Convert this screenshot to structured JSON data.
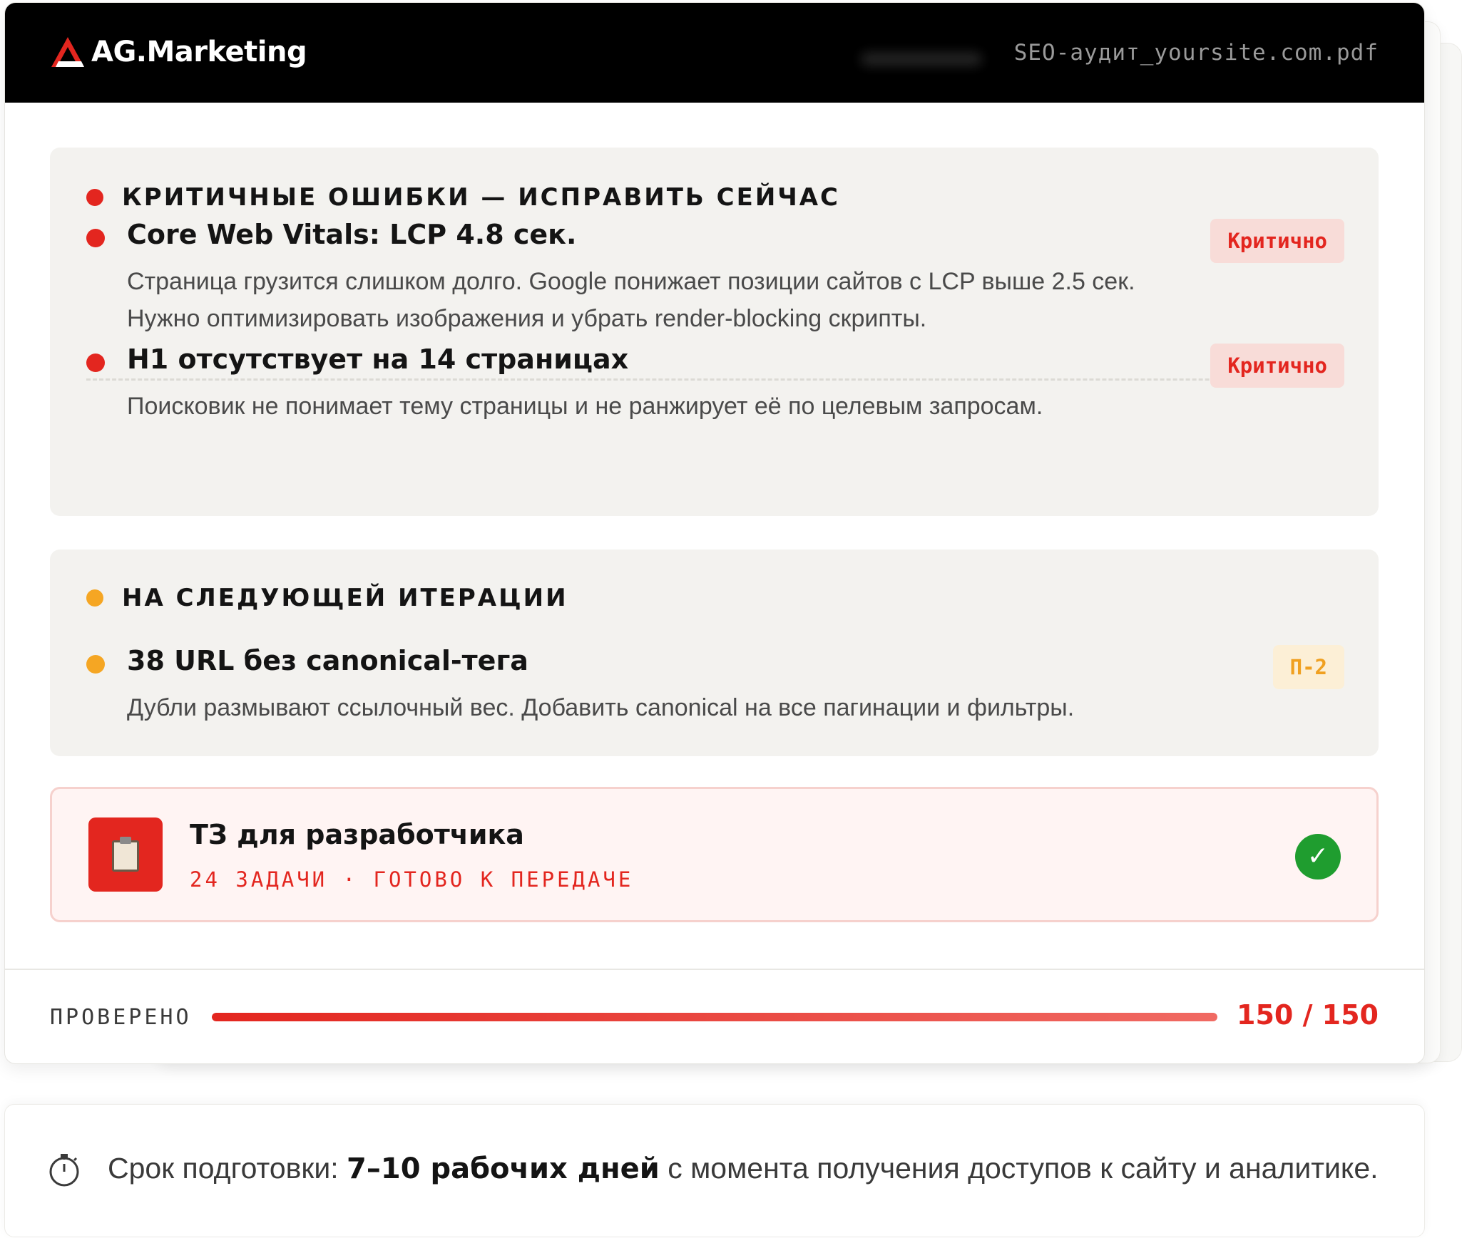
{
  "brand": {
    "logo_text": "AG.Marketing",
    "accent": "#e3261f"
  },
  "header": {
    "filename": "SEO-аудит_yoursite.com.pdf"
  },
  "critical_section": {
    "title": "КРИТИЧНЫЕ ОШИБКИ — ИСПРАВИТЬ СЕЙЧАС",
    "dot_color": "#e3261f",
    "items": [
      {
        "title": "Core Web Vitals: LCP 4.8 сек.",
        "desc_line1": "Страница грузится слишком долго. Google понижает позиции сайтов с LCP выше 2.5 сек.",
        "desc_line2": "Нужно оптимизировать изображения и убрать render-blocking скрипты.",
        "badge": "Критично"
      },
      {
        "title": "H1 отсутствует на 14 страницах",
        "desc_line1": "Поисковик не понимает тему страницы и не ранжирует её по целевым запросам.",
        "badge": "Критично"
      }
    ]
  },
  "next_section": {
    "title": "НА СЛЕДУЮЩЕЙ ИТЕРАЦИИ",
    "dot_color": "#f5a623",
    "items": [
      {
        "title": "38 URL без canonical-тега",
        "desc_line1": "Дубли размывают ссылочный вес. Добавить canonical на все пагинации и фильтры.",
        "badge": "П-2"
      }
    ]
  },
  "tz_card": {
    "icon": "clipboard-icon",
    "title": "ТЗ для разработчика",
    "subtitle": "24 ЗАДАЧИ · ГОТОВО К ПЕРЕДАЧЕ",
    "status_icon": "check-icon",
    "check_glyph": "✓"
  },
  "progress": {
    "label": "ПРОВЕРЕНО",
    "count": "150 / 150",
    "fraction": 1.0
  },
  "note": {
    "icon": "stopwatch-icon",
    "prefix": "Срок подготовки: ",
    "bold": "7–10 рабочих дней",
    "suffix": " с момента получения доступов к сайту и аналитике."
  }
}
